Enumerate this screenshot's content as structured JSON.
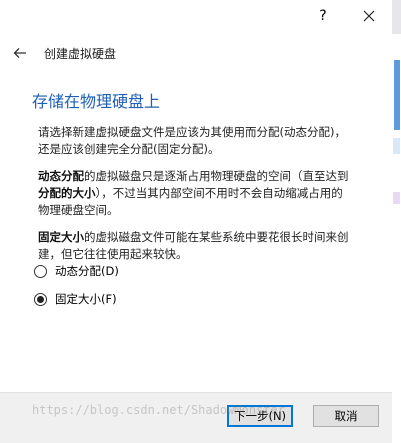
{
  "titlebar": {
    "help_label": "?"
  },
  "nav": {
    "title": "创建虚拟硬盘"
  },
  "heading": "存储在物理硬盘上",
  "description": {
    "p1": "请选择新建虚拟硬盘文件是应该为其使用而分配(动态分配)，还是应该创建完全分配(固定分配)。",
    "p2_bold1": "动态分配",
    "p2_text1": "的虚拟磁盘只是逐渐占用物理硬盘的空间（直至达到",
    "p2_bold2": "分配的大小",
    "p2_text2": "），不过当其内部空间不用时不会自动缩减占用的物理硬盘空间。",
    "p3_bold": "固定大小",
    "p3_text": "的虚拟磁盘文件可能在某些系统中要花很长时间来创建，但它往往使用起来较快。"
  },
  "options": [
    {
      "label": "动态分配(D)",
      "selected": false
    },
    {
      "label": "固定大小(F)",
      "selected": true
    }
  ],
  "footer": {
    "next_label": "下一步(N)",
    "cancel_label": "取消"
  },
  "watermark": "https://blog.csdn.net/ShadowMonster"
}
